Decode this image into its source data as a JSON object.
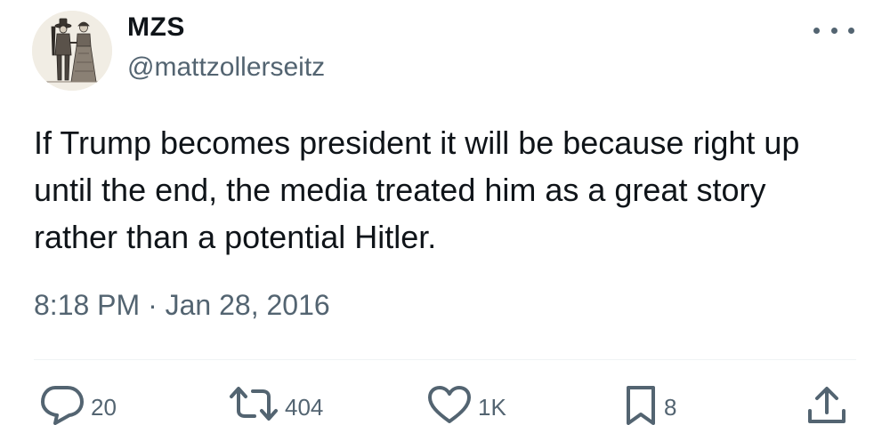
{
  "tweet": {
    "author": {
      "display_name": "MZS",
      "handle": "@mattzollerseitz"
    },
    "text_lines": [
      "If Trump becomes president it will be because right up",
      "until the end, the media treated him as a great story",
      "rather than a potential Hitler."
    ],
    "timestamp": "8:18 PM · Jan 28, 2016",
    "actions": {
      "replies": "20",
      "reposts": "404",
      "likes": "1K",
      "bookmarks": "8"
    }
  },
  "colors": {
    "text": "#0f1419",
    "secondary": "#536471",
    "divider": "#eff3f4",
    "background": "#ffffff"
  },
  "icons": [
    "more-icon",
    "reply-icon",
    "repost-icon",
    "like-icon",
    "bookmark-icon",
    "share-icon"
  ]
}
